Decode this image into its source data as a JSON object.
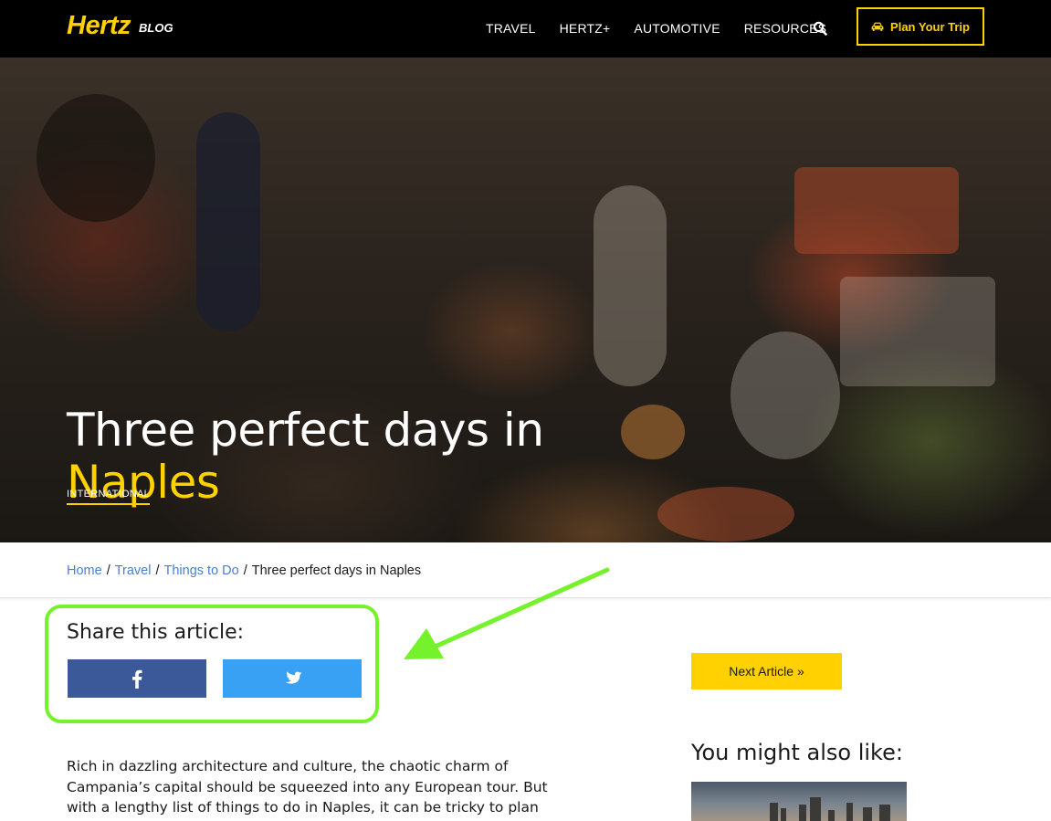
{
  "header": {
    "logo": "Hertz",
    "logo_sub": "BLOG",
    "nav": [
      "TRAVEL",
      "HERTZ+",
      "AUTOMOTIVE",
      "RESOURCES"
    ],
    "search_icon": "search-icon",
    "cta_label": "Plan Your Trip",
    "cta_icon": "car-icon",
    "brand_color": "#ffd100"
  },
  "hero": {
    "title_line1": "Three perfect days in",
    "title_line2": "Naples",
    "category": "INTERNATIONAL"
  },
  "breadcrumb": {
    "items": [
      "Home",
      "Travel",
      "Things to Do"
    ],
    "current": "Three perfect days in Naples",
    "separator": "/",
    "link_color": "#4a7fd0"
  },
  "share": {
    "title": "Share this article:",
    "facebook_icon": "facebook-icon",
    "twitter_icon": "twitter-icon",
    "facebook_color": "#3b5998",
    "twitter_color": "#38a1f3",
    "highlight_color": "#76f22c"
  },
  "sidebar": {
    "next_label": "Next Article »",
    "also_like_title": "You might also like:"
  },
  "article": {
    "intro": "Rich in dazzling architecture and culture, the chaotic charm of Campania’s capital should be squeezed into any European tour. But with a lengthy list of things to do in Naples, it can be tricky to plan"
  }
}
